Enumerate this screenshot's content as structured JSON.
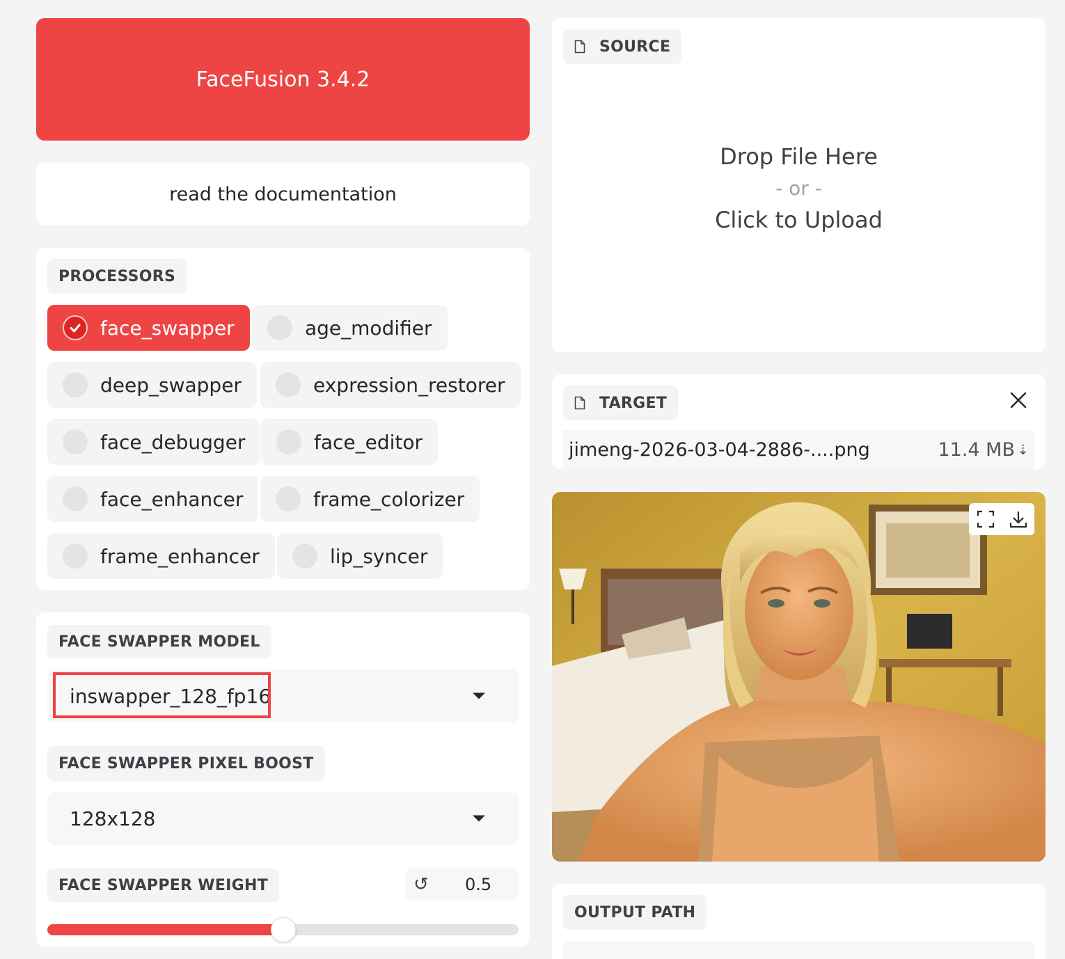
{
  "app": {
    "title": "FaceFusion 3.4.2",
    "docs_link": "read the documentation"
  },
  "processors": {
    "label": "PROCESSORS",
    "items": [
      {
        "label": "face_swapper",
        "checked": true
      },
      {
        "label": "age_modifier",
        "checked": false
      },
      {
        "label": "deep_swapper",
        "checked": false
      },
      {
        "label": "expression_restorer",
        "checked": false
      },
      {
        "label": "face_debugger",
        "checked": false
      },
      {
        "label": "face_editor",
        "checked": false
      },
      {
        "label": "face_enhancer",
        "checked": false
      },
      {
        "label": "frame_colorizer",
        "checked": false
      },
      {
        "label": "frame_enhancer",
        "checked": false
      },
      {
        "label": "lip_syncer",
        "checked": false
      }
    ]
  },
  "face_swapper_model": {
    "label": "FACE SWAPPER MODEL",
    "value": "inswapper_128_fp16"
  },
  "face_swapper_pixel_boost": {
    "label": "FACE SWAPPER PIXEL BOOST",
    "value": "128x128"
  },
  "face_swapper_weight": {
    "label": "FACE SWAPPER WEIGHT",
    "value": "0.5",
    "fraction": 0.5,
    "reset_icon": "reset-icon"
  },
  "source": {
    "label": "SOURCE",
    "icon": "file-icon",
    "drop_text": "Drop File Here",
    "or_text": "- or -",
    "upload_text": "Click to Upload"
  },
  "target": {
    "label": "TARGET",
    "icon": "file-icon",
    "file_name": "jimeng-2026-03-04-2886-....png",
    "file_size": "11.4 MB",
    "download_glyph": "⇣",
    "close_icon": "close-icon"
  },
  "preview": {
    "fullscreen_icon": "fullscreen-icon",
    "download_icon": "download-icon"
  },
  "output": {
    "label": "OUTPUT PATH"
  },
  "colors": {
    "accent": "#ef4444",
    "background": "#f4f4f5",
    "card": "#ffffff"
  }
}
